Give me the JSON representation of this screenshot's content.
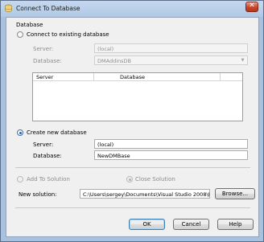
{
  "window": {
    "title": "Connect To Database",
    "close_glyph": "✕"
  },
  "database_section": {
    "label": "Database"
  },
  "existing": {
    "radio_label": "Connect to existing database",
    "server_label": "Server:",
    "server_value": "(local)",
    "database_label": "Database:",
    "database_value": "DMAddinsDB",
    "list_headers": [
      "Server",
      "Database"
    ]
  },
  "create_new": {
    "radio_label": "Create new database",
    "server_label": "Server:",
    "server_value": "(local)",
    "database_label": "Database:",
    "database_value": "NewDMBase"
  },
  "solution": {
    "add_label": "Add To Solution",
    "close_label": "Close Solution",
    "new_solution_label": "New solution:",
    "path_value": "C:\\Users\\sergey\\Documents\\Visual Studio 2008\\Pr",
    "browse_label": "Browse..."
  },
  "buttons": {
    "ok": "OK",
    "cancel": "Cancel",
    "help": "Help"
  },
  "colors": {
    "window_frame": "#a7c1de",
    "client_bg": "#f0f0f0",
    "close_button": "#c7432a",
    "disabled_text": "#8d8d8d"
  }
}
